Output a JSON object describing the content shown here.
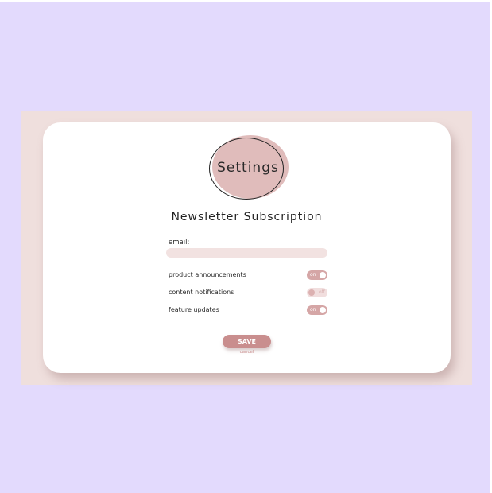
{
  "logo": {
    "text": "Settings"
  },
  "form": {
    "title": "Newsletter Subscription",
    "email": {
      "label": "email:",
      "value": "",
      "placeholder": ""
    },
    "options": [
      {
        "label": "product announcements",
        "state": "on"
      },
      {
        "label": "content notifications",
        "state": "off"
      },
      {
        "label": "feature updates",
        "state": "on"
      }
    ],
    "save_label": "SAVE",
    "cancel_label": "cancel"
  },
  "colors": {
    "page_background": "#e3dafd",
    "backdrop": "#efdfdd",
    "card": "#ffffff",
    "accent": "#c98e8e",
    "logo_blob": "#e0bcbb",
    "email_field": "#f2e2e1"
  }
}
